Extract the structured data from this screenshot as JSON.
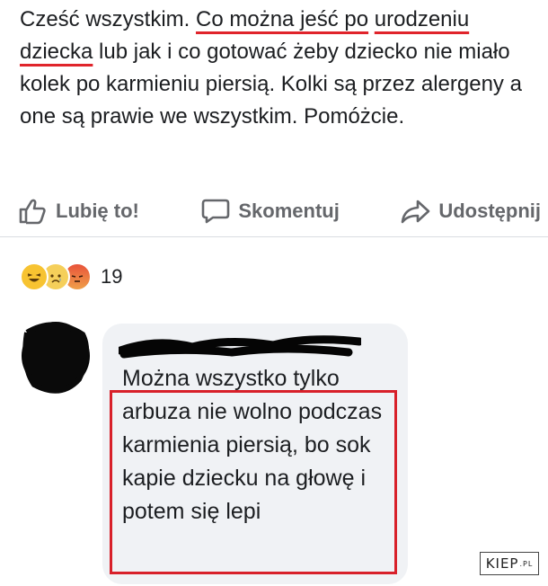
{
  "post": {
    "text_part1": "Cześć wszystkim. ",
    "text_underlined_1": "Co można jeść po",
    "text_underlined_2": "urodzeniu dziecka",
    "text_part2": " lub jak i co gotować żeby dziecko nie miało kolek po karmieniu piersią. Kolki są przez alergeny a one są prawie we wszystkim. Pomóżcie."
  },
  "actions": {
    "like_label": "Lubię to!",
    "comment_label": "Skomentuj",
    "share_label": "Udostępnij"
  },
  "reactions": {
    "types": [
      "haha-icon",
      "sad-icon",
      "angry-icon"
    ],
    "count": "19"
  },
  "comment": {
    "text": "Można wszystko tylko arbuza nie wolno podczas karmienia piersią, bo sok kapie dziecku na głowę i potem się lepi"
  },
  "watermark": {
    "text": "KIEP",
    "suffix": ".PL"
  },
  "colors": {
    "highlight_red": "#d8202a",
    "action_gray": "#65676b",
    "bubble_bg": "#f0f2f5"
  }
}
